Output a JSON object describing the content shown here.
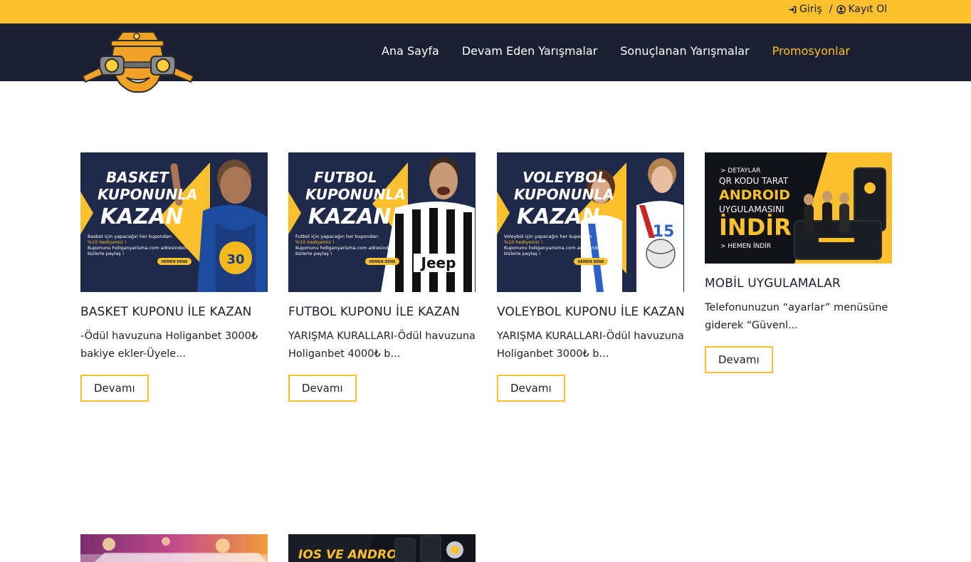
{
  "auth": {
    "login": "Giriş",
    "separator": "/",
    "register": "Kayıt Ol"
  },
  "nav": [
    {
      "label": "Ana Sayfa",
      "active": false
    },
    {
      "label": "Devam Eden Yarışmalar",
      "active": false
    },
    {
      "label": "Sonuçlanan Yarışmalar",
      "active": false
    },
    {
      "label": "Promosyonlar",
      "active": true
    }
  ],
  "cards": [
    {
      "banner": {
        "heading": [
          "BASKET",
          "KUPONUNLA",
          "KAZAN"
        ],
        "small": [
          "Basket için yapacağın her kupondan",
          "%10 hediyemiz !",
          "Kuponunu holiganyarisma.com adresinden",
          "bizlerle paylaş !"
        ],
        "button": "HEMEN DENE",
        "jersey_number": "30"
      },
      "title": "BASKET KUPONU İLE KAZAN",
      "excerpt": "-Ödül havuzuna Holiganbet 3000₺ bakiye ekler-Üyele...",
      "button": "Devamı"
    },
    {
      "banner": {
        "heading": [
          "FUTBOL",
          "KUPONUNLA",
          "KAZAN"
        ],
        "small": [
          "Futbol için yapacağın her kupondan",
          "%10 hediyemiz !",
          "Kuponunu holiganyarisma.com adresinden",
          "bizlerle paylaş !"
        ],
        "button": "HEMEN DENE",
        "jersey_text": "Jeep"
      },
      "title": "FUTBOL KUPONU İLE KAZAN",
      "excerpt": "YARIŞMA KURALLARI-Ödül havuzuna Holiganbet 4000₺ b...",
      "button": "Devamı"
    },
    {
      "banner": {
        "heading": [
          "VOLEYBOL",
          "KUPONUNLA",
          "KAZAN"
        ],
        "small": [
          "Voleybol için yapacağın her kupondan",
          "%10 hediyemiz !",
          "Kuponunu holiganyarisma.com adresinden",
          "bizlerle paylaş !"
        ],
        "button": "HEMEN DENE",
        "jersey_number": "15"
      },
      "title": "VOLEYBOL KUPONU İLE KAZAN",
      "excerpt": "YARIŞMA KURALLARI-Ödül havuzuna Holiganbet 3000₺ b...",
      "button": "Devamı"
    },
    {
      "banner": {
        "lines": [
          "> DETAYLAR",
          "QR KODU TARAT",
          "ANDROID",
          "UYGULAMASINI",
          "İNDİR",
          "> HEMEN İNDİR"
        ]
      },
      "title": "MOBİL UYGULAMALAR",
      "excerpt": "Telefonunuzun “ayarlar” menüsüne giderek “Güvenl...",
      "button": "Devamı"
    }
  ],
  "bottom_banners": [
    {
      "text": ""
    },
    {
      "text": "IOS VE ANDROID"
    }
  ],
  "colors": {
    "accent": "#fbc02d",
    "navy": "#1b2032",
    "banner_navy": "#1f2a4a"
  }
}
